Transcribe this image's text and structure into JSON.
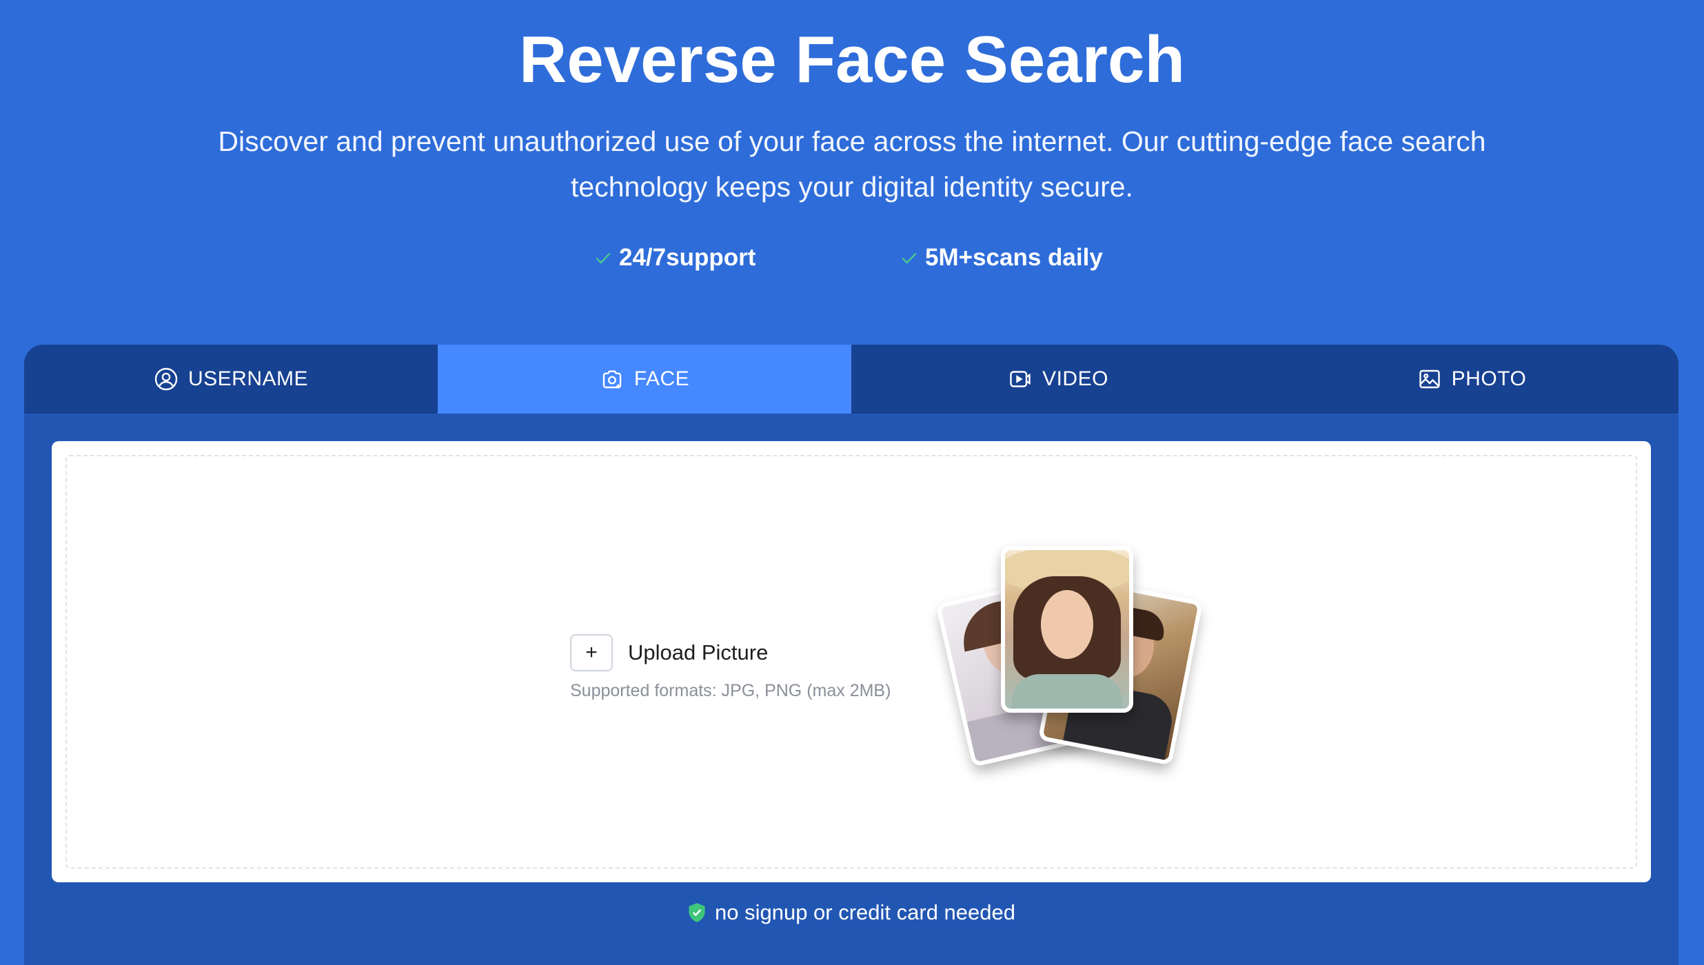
{
  "hero": {
    "title": "Reverse Face Search",
    "description": "Discover and prevent unauthorized use of your face across the internet. Our cutting-edge face search technology keeps your digital identity secure."
  },
  "features": [
    {
      "icon": "check-icon",
      "label": "24/7support"
    },
    {
      "icon": "check-icon",
      "label": "5M+scans daily"
    }
  ],
  "tabs": [
    {
      "id": "username",
      "icon": "user-circle-icon",
      "label": "USERNAME",
      "active": false
    },
    {
      "id": "face",
      "icon": "face-camera-icon",
      "label": "FACE",
      "active": true
    },
    {
      "id": "video",
      "icon": "video-icon",
      "label": "VIDEO",
      "active": false
    },
    {
      "id": "photo",
      "icon": "image-icon",
      "label": "PHOTO",
      "active": false
    }
  ],
  "upload": {
    "button_symbol": "+",
    "label": "Upload Picture",
    "formats": "Supported formats: JPG, PNG (max 2MB)"
  },
  "footer": {
    "icon": "shield-check-icon",
    "note": "no signup or credit card needed"
  },
  "colors": {
    "background": "#2e6cd9",
    "panel": "#2256b3",
    "tab_bar": "#174191",
    "tab_active": "#4588ff",
    "check": "#4bd18a"
  }
}
